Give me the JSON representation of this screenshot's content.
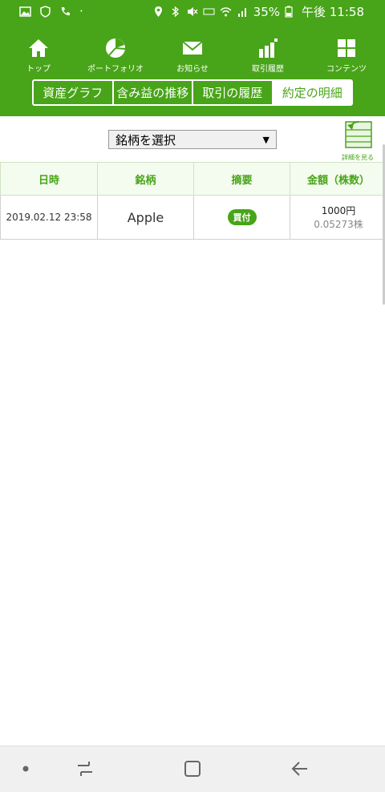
{
  "status": {
    "battery": "35%",
    "time": "午後 11:58"
  },
  "nav": {
    "items": [
      {
        "label": "トップ",
        "icon": "home-icon"
      },
      {
        "label": "ポートフォリオ",
        "icon": "pie-chart-icon"
      },
      {
        "label": "お知らせ",
        "icon": "mail-icon"
      },
      {
        "label": "取引履歴",
        "icon": "bar-chart-icon"
      },
      {
        "label": "コンテンツ",
        "icon": "grid-icon"
      }
    ]
  },
  "subtabs": [
    "資産グラフ",
    "含み益の推移",
    "取引の履歴",
    "約定の明細"
  ],
  "selector": {
    "value": "銘柄を選択"
  },
  "detail_button": {
    "label": "詳細を見る"
  },
  "table": {
    "headers": [
      "日時",
      "銘柄",
      "摘要",
      "金額（株数）"
    ],
    "rows": [
      {
        "datetime": "2019.02.12 23:58",
        "stock": "Apple",
        "type": "買付",
        "amount": "1000円",
        "shares": "0.05273株"
      }
    ]
  },
  "colors": {
    "brand": "#48a418"
  }
}
